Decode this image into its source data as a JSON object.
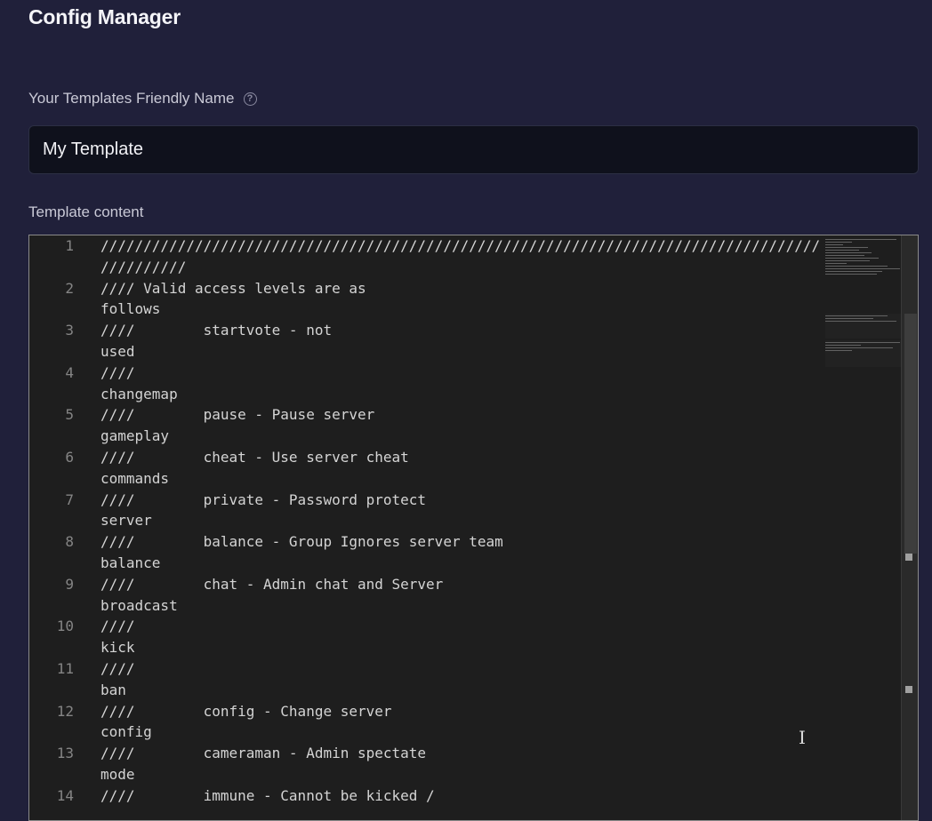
{
  "header": {
    "title": "Config Manager"
  },
  "template_name": {
    "label": "Your Templates Friendly Name",
    "value": "My Template",
    "help_icon": "question-circle-icon"
  },
  "content": {
    "label": "Template content",
    "lines": [
      {
        "num": "1",
        "parts": [
          "////////////////////////////////////////////////////////////////////////////////////",
          "//////////"
        ]
      },
      {
        "num": "2",
        "parts": [
          "//// Valid access levels are as",
          "follows"
        ]
      },
      {
        "num": "3",
        "parts": [
          "////        startvote - not",
          "used"
        ]
      },
      {
        "num": "4",
        "parts": [
          "////",
          "changemap"
        ]
      },
      {
        "num": "5",
        "parts": [
          "////        pause - Pause server",
          "gameplay"
        ]
      },
      {
        "num": "6",
        "parts": [
          "////        cheat - Use server cheat",
          "commands"
        ]
      },
      {
        "num": "7",
        "parts": [
          "////        private - Password protect",
          "server"
        ]
      },
      {
        "num": "8",
        "parts": [
          "////        balance - Group Ignores server team",
          "balance"
        ]
      },
      {
        "num": "9",
        "parts": [
          "////        chat - Admin chat and Server",
          "broadcast"
        ]
      },
      {
        "num": "10",
        "parts": [
          "////",
          "kick"
        ]
      },
      {
        "num": "11",
        "parts": [
          "////",
          "ban"
        ]
      },
      {
        "num": "12",
        "parts": [
          "////        config - Change server",
          "config"
        ]
      },
      {
        "num": "13",
        "parts": [
          "////        cameraman - Admin spectate",
          "mode"
        ]
      },
      {
        "num": "14",
        "parts": [
          "////        immune - Cannot be kicked /",
          ""
        ]
      }
    ]
  }
}
